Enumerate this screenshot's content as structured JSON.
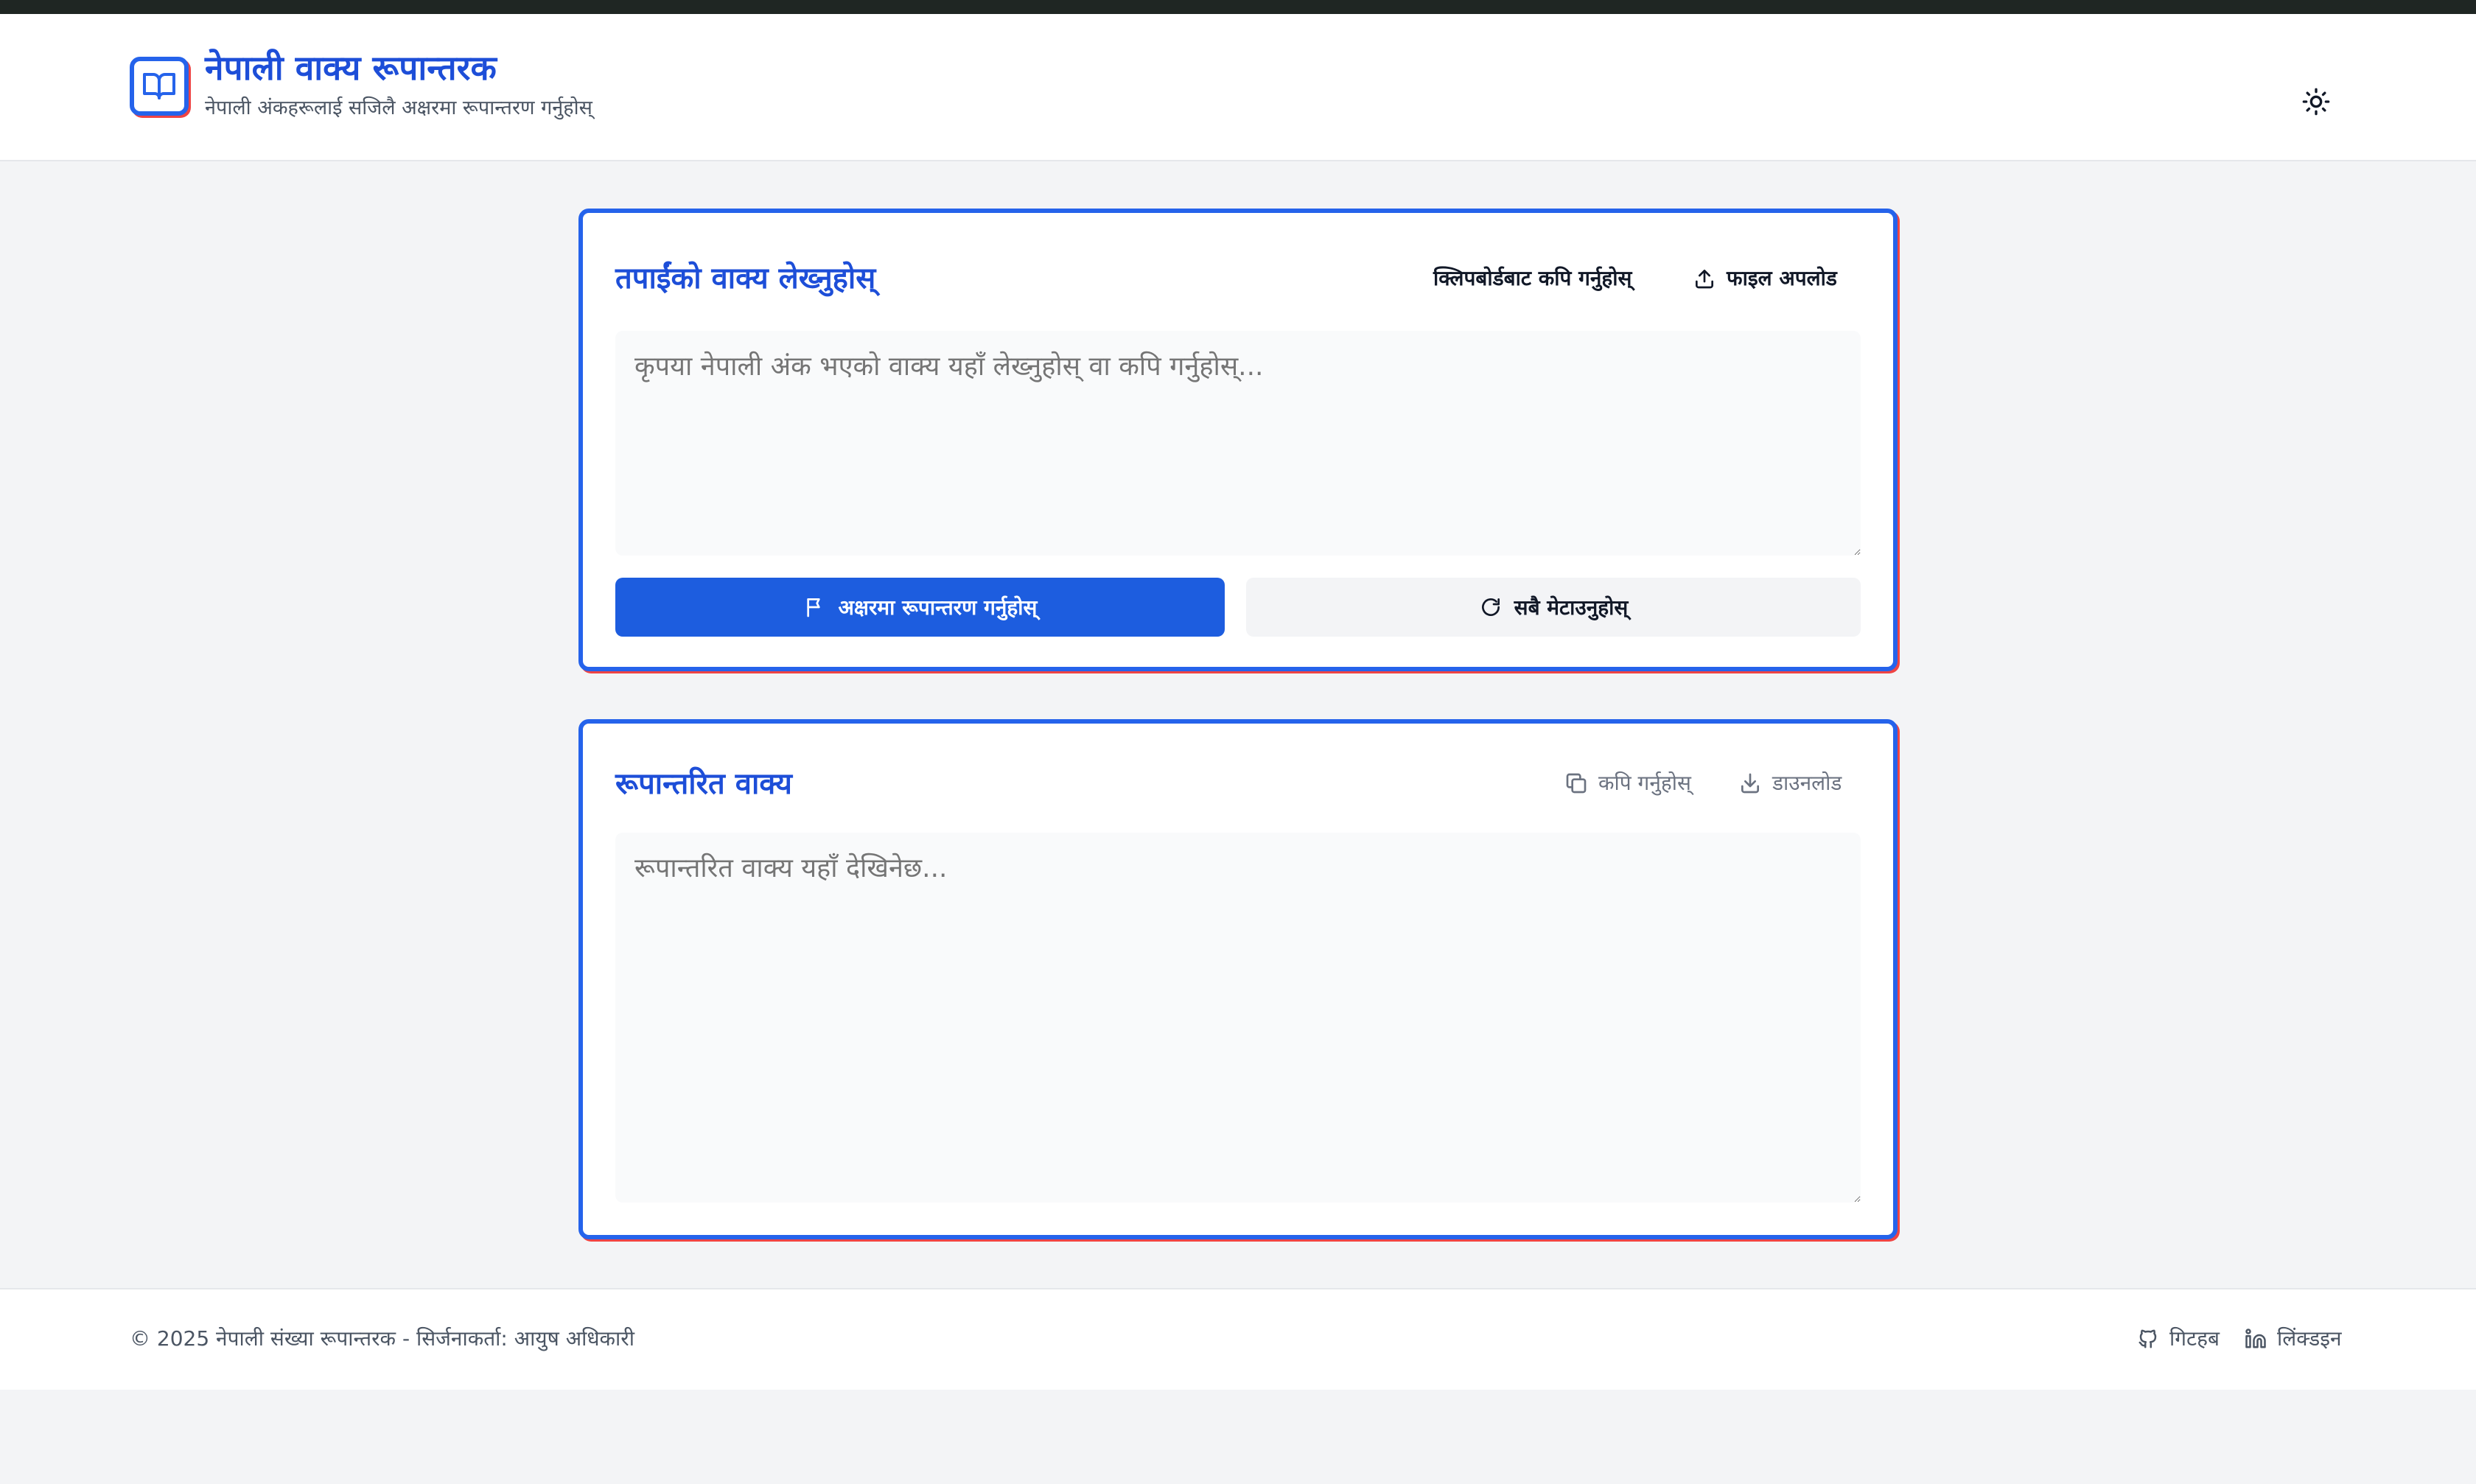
{
  "header": {
    "logo_icon": "open-book-icon",
    "title": "नेपाली वाक्य रूपान्तरक",
    "subtitle": "नेपाली अंकहरूलाई सजिलै अक्षरमा रूपान्तरण गर्नुहोस्",
    "theme_toggle_icon": "sun-icon"
  },
  "input_card": {
    "title": "तपाईंको वाक्य लेख्नुहोस्",
    "clipboard_label": "क्लिपबोर्डबाट कपि गर्नुहोस्",
    "upload_label": "फाइल अपलोड",
    "upload_icon": "upload-icon",
    "textarea_value": "",
    "textarea_placeholder": "कृपया नेपाली अंक भएको वाक्य यहाँ लेख्नुहोस् वा कपि गर्नुहोस्...",
    "convert_label": "अक्षरमा रूपान्तरण गर्नुहोस्",
    "convert_icon": "flag-icon",
    "reset_label": "सबै मेटाउनुहोस्",
    "reset_icon": "refresh-icon"
  },
  "output_card": {
    "title": "रूपान्तरित वाक्य",
    "copy_label": "कपि गर्नुहोस्",
    "copy_icon": "copy-icon",
    "download_label": "डाउनलोड",
    "download_icon": "download-icon",
    "textarea_value": "",
    "textarea_placeholder": "रूपान्तरित वाक्य यहाँ देखिनेछ..."
  },
  "footer": {
    "copyright": "© 2025 नेपाली संख्या रूपान्तरक - सिर्जनाकर्ता: आयुष अधिकारी",
    "github_label": "गिटहब",
    "github_icon": "github-icon",
    "linkedin_label": "लिंक्डइन",
    "linkedin_icon": "linkedin-icon"
  },
  "colors": {
    "accent": "#2563eb",
    "accent_shadow": "#ef4444",
    "primary_button": "#1d5ddf",
    "background": "#f3f4f6"
  }
}
